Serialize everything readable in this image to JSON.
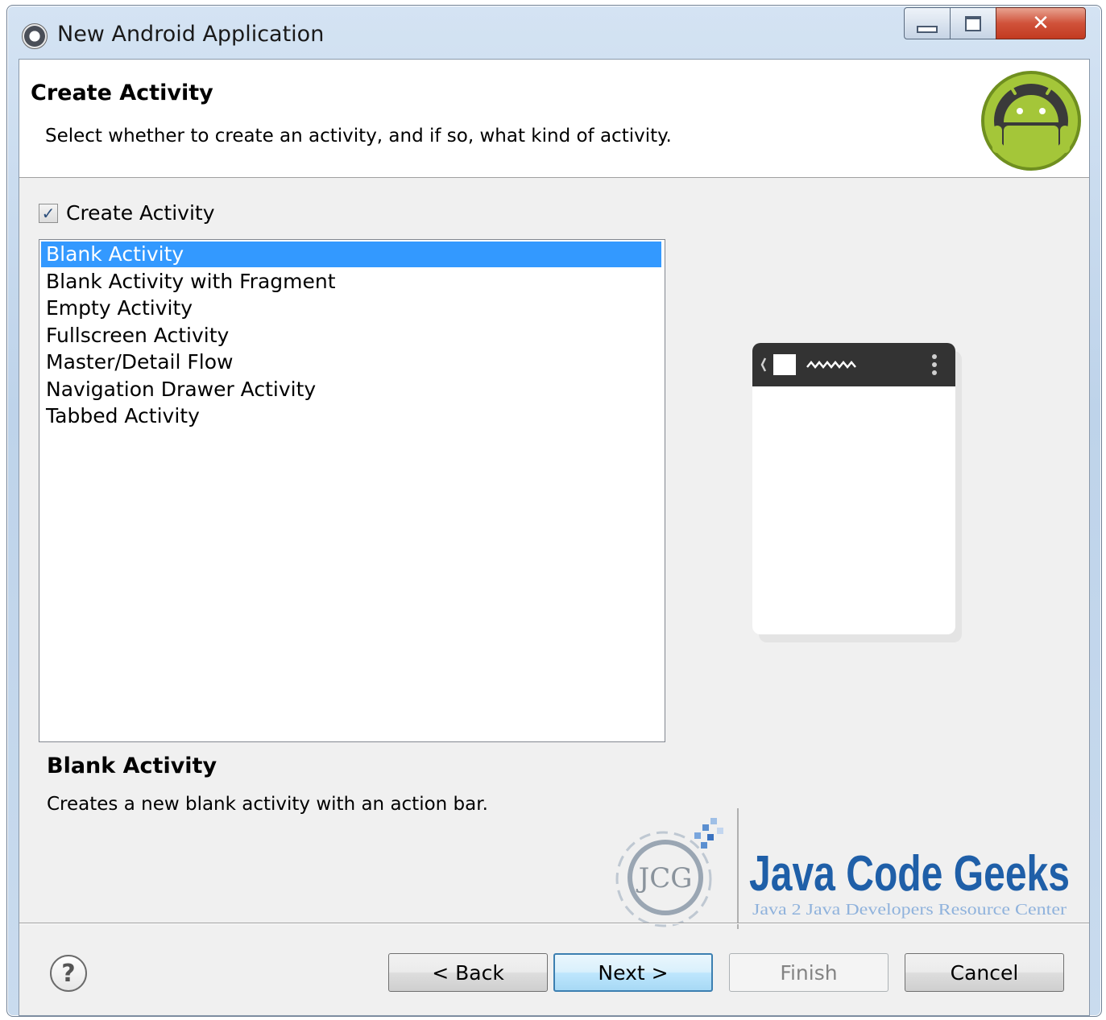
{
  "window": {
    "title": "New Android Application"
  },
  "header": {
    "title": "Create Activity",
    "description": "Select whether to create an activity, and if so, what kind of activity."
  },
  "create_activity": {
    "label": "Create Activity",
    "checked": true
  },
  "activity_list": {
    "items": [
      "Blank Activity",
      "Blank Activity with Fragment",
      "Empty Activity",
      "Fullscreen Activity",
      "Master/Detail Flow",
      "Navigation Drawer Activity",
      "Tabbed Activity"
    ],
    "selected": "Blank Activity"
  },
  "details": {
    "title": "Blank Activity",
    "text": "Creates a new blank activity with an action bar."
  },
  "watermark": {
    "logo_letters": "JCG",
    "brand": "Java Code Geeks",
    "tagline": "Java 2 Java Developers Resource Center"
  },
  "buttons": {
    "back": "< Back",
    "next": "Next >",
    "finish": "Finish",
    "cancel": "Cancel"
  },
  "colors": {
    "selection": "#3399ff",
    "android_green": "#a4c639",
    "watermark_blue": "#1f5fa8"
  }
}
